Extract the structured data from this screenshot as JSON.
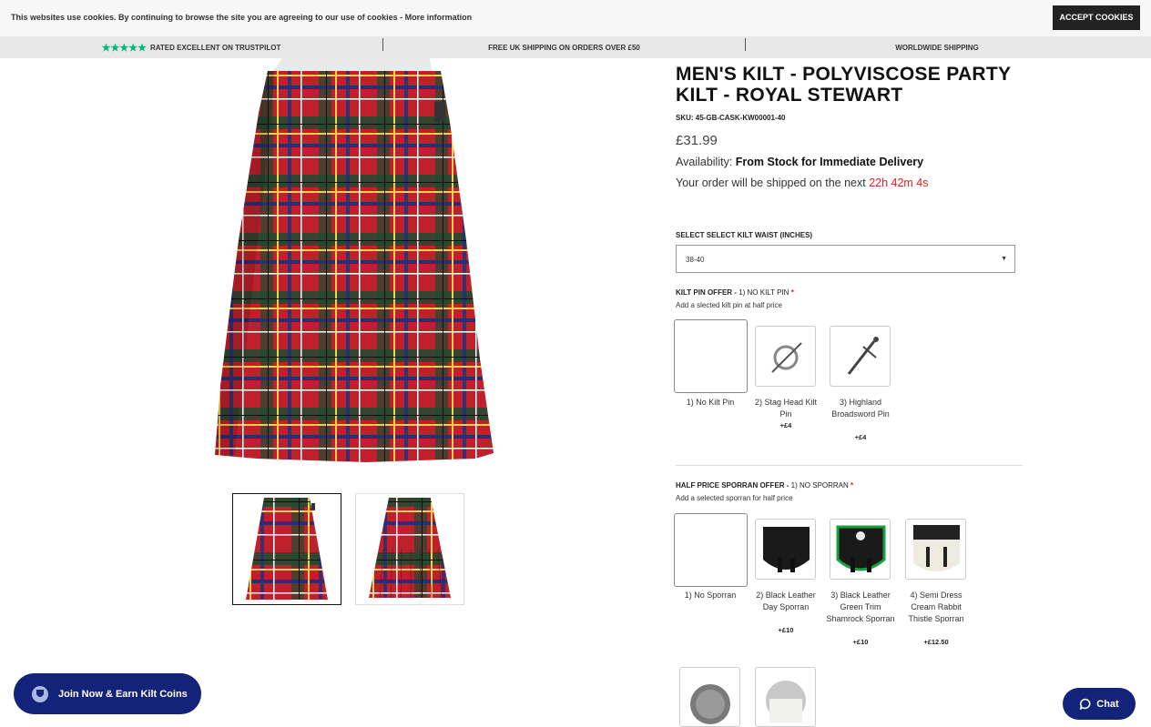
{
  "cookie_bar": {
    "message": "This websites use cookies. By continuing to browse the site you are agreeing to our use of cookies - ",
    "more_info": "More information",
    "accept_label": "ACCEPT COOKIES"
  },
  "usp": {
    "rating_stars": "★★★★★",
    "rating_text": "RATED EXCELLENT ON TRUSTPILOT",
    "shipping_text": "FREE UK SHIPPING ON ORDERS OVER £50",
    "worldwide_text": "WORLDWIDE SHIPPING"
  },
  "product": {
    "title": "MEN'S KILT - POLYVISCOSE PARTY KILT - ROYAL STEWART",
    "sku": "SKU: 45-GB-CASK-KW00001-40",
    "price": "£31.99",
    "availability_label": "Availability: ",
    "availability_value": "From Stock for Immediate Delivery",
    "shipping_prefix": "Your order will be shipped on the next ",
    "shipping_timer": "22h 42m 4s"
  },
  "waist": {
    "label": "SELECT SELECT KILT WAIST (INCHES)",
    "value": "38-40"
  },
  "kilt_pin": {
    "label": "KILT PIN OFFER - ",
    "selected": "1) NO KILT PIN",
    "required": "*",
    "subtitle": "Add a slected kilt pin at half price",
    "options": [
      {
        "label": "1) No Kilt Pin",
        "price": ""
      },
      {
        "label": "2) Stag Head Kilt Pin",
        "price": "+£4"
      },
      {
        "label": "3) Highland Broadsword Pin",
        "price": "+£4"
      }
    ]
  },
  "sporran": {
    "label": "HALF PRICE SPORRAN OFFER - ",
    "selected": "1) NO SPORRAN",
    "required": "*",
    "subtitle": "Add a selected sporran for half price",
    "options": [
      {
        "label": "1) No Sporran",
        "price": ""
      },
      {
        "label": "2) Black Leather Day Sporran",
        "price": "+£10"
      },
      {
        "label": "3) Black Leather Green Trim Shamrock Sporran",
        "price": "+£10"
      },
      {
        "label": "4) Semi Dress Cream Rabbit Thistle Sporran",
        "price": "+£12.50"
      }
    ]
  },
  "floating": {
    "join_label": "Join Now & Earn Kilt Coins",
    "chat_label": "Chat"
  },
  "colors": {
    "tartan_red": "#c0202c",
    "brand_navy": "#14237a",
    "trustpilot_green": "#00b67a",
    "timer_red": "#e02020"
  }
}
